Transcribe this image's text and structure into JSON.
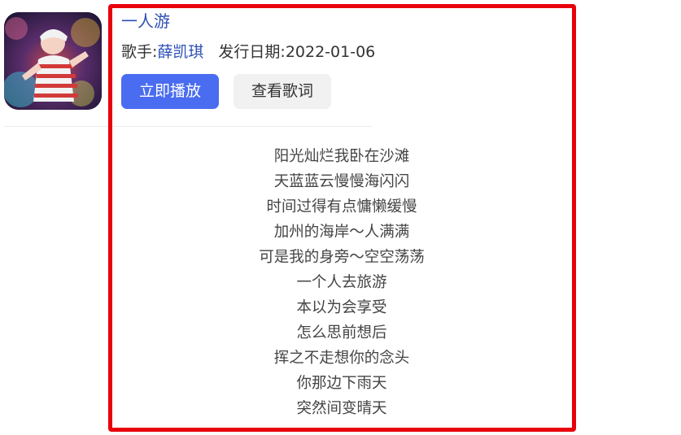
{
  "song": {
    "title": "一人游",
    "artist_label": "歌手:",
    "artist_name": "薛凯琪",
    "release_label": "发行日期:",
    "release_date": "2022-01-06",
    "cover_icon": "album-cover-image"
  },
  "actions": {
    "play_label": "立即播放",
    "lyrics_label": "查看歌词"
  },
  "lyrics": [
    "阳光灿烂我卧在沙滩",
    "天蓝蓝云慢慢海闪闪",
    "时间过得有点慵懒缓慢",
    "加州的海岸～人满满",
    "可是我的身旁～空空荡荡",
    "一个人去旅游",
    "本以为会享受",
    "怎么思前想后",
    "挥之不走想你的念头",
    "你那边下雨天",
    "突然间变晴天"
  ],
  "colors": {
    "title_blue": "#2c4fb6",
    "play_button": "#4a6cf0",
    "highlight_red": "#e8000b"
  }
}
